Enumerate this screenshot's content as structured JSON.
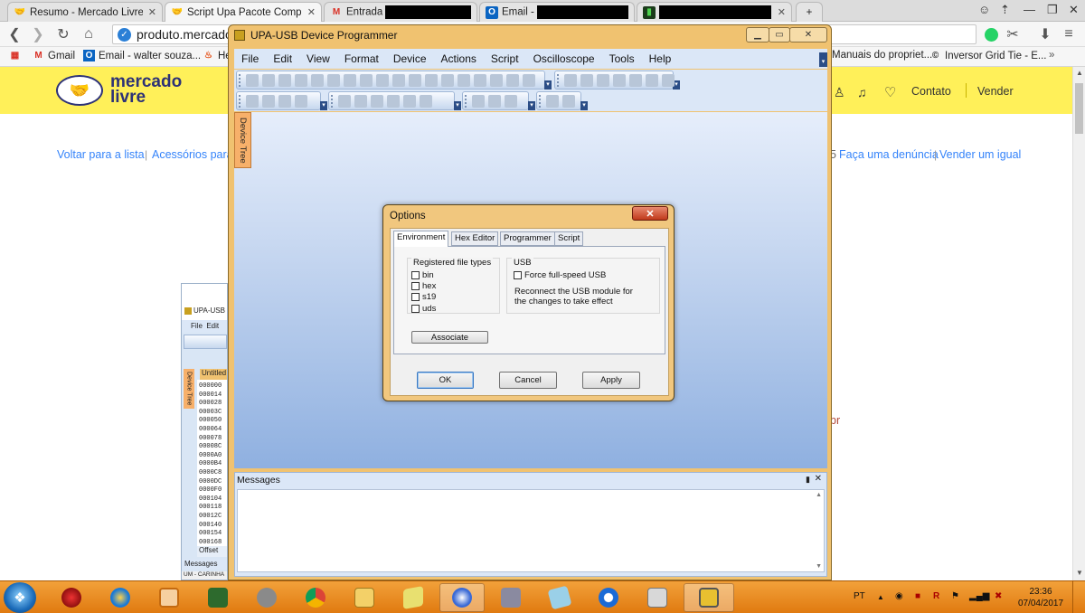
{
  "browser": {
    "tabs": [
      {
        "title": "Resumo - Mercado Livre",
        "icon": "mercado-livre-icon"
      },
      {
        "title": "Script Upa Pacote Complet",
        "icon": "mercado-livre-icon"
      },
      {
        "title": "Entrada",
        "icon": "gmail-icon"
      },
      {
        "title": "Email -",
        "icon": "outlook-icon"
      },
      {
        "title": "",
        "icon": "app-icon"
      }
    ],
    "address": "produto.mercado",
    "bookmarks": [
      {
        "label": "Gmail",
        "icon": "gmail-icon"
      },
      {
        "label": "Email - walter souza...",
        "icon": "outlook-icon"
      },
      {
        "label": "He",
        "icon": "flame-icon"
      },
      {
        "label": "Manuais do propriet...",
        "icon": "page-icon"
      },
      {
        "label": "Inversor Grid Tie - E...",
        "icon": "site-icon"
      }
    ]
  },
  "mercadolivre": {
    "logo_line1": "mercado",
    "logo_line2": "livre",
    "contato": "Contato",
    "vender": "Vender",
    "voltar": "Voltar para a lista",
    "acessorios": "Acessórios para",
    "denuncia": "Faça uma denúncia",
    "vender_igual": "Vender um igual",
    "digit": "5",
    "partial_text": "br"
  },
  "bg_upa": {
    "title": "UPA-USB",
    "menu_file": "File",
    "menu_edit": "Edit",
    "tab": "Untitled",
    "tree": "Device Tree",
    "addresses": [
      "000000",
      "000014",
      "000028",
      "00003C",
      "000050",
      "000064",
      "000078",
      "00008C",
      "0000A0",
      "0000B4",
      "0000C8",
      "0000DC",
      "0000F0",
      "000104",
      "000118",
      "00012C",
      "000140",
      "000154",
      "000168"
    ],
    "offset": "Offset",
    "messages": "Messages",
    "status": "UM - CARINHA"
  },
  "upa": {
    "title": "UPA-USB Device Programmer",
    "menu": [
      "File",
      "Edit",
      "View",
      "Format",
      "Device",
      "Actions",
      "Script",
      "Oscilloscope",
      "Tools",
      "Help"
    ],
    "device_tree": "Device Tree",
    "messages_label": "Messages"
  },
  "options": {
    "title": "Options",
    "tabs": [
      "Environment",
      "Hex Editor",
      "Programmer",
      "Script"
    ],
    "registered_label": "Registered file types",
    "file_types": [
      "bin",
      "hex",
      "s19",
      "uds"
    ],
    "associate": "Associate",
    "usb_label": "USB",
    "force_usb": "Force full-speed USB",
    "reconnect_line1": "Reconnect the USB module for",
    "reconnect_line2": "the changes to take effect",
    "ok": "OK",
    "cancel": "Cancel",
    "apply": "Apply"
  },
  "taskbar": {
    "lang": "PT",
    "time": "23:36",
    "date": "07/04/2017"
  }
}
